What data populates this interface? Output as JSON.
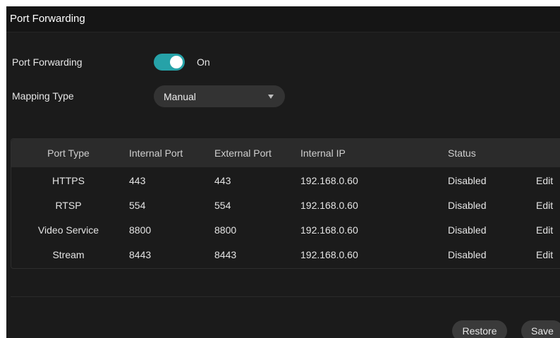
{
  "header": {
    "title": "Port Forwarding"
  },
  "form": {
    "port_forwarding_label": "Port Forwarding",
    "port_forwarding_state": "On",
    "port_forwarding_enabled": true,
    "mapping_type_label": "Mapping Type",
    "mapping_type_value": "Manual"
  },
  "table": {
    "headers": [
      "Port Type",
      "Internal Port",
      "External Port",
      "Internal IP",
      "Status"
    ],
    "rows": [
      {
        "type": "HTTPS",
        "internal_port": "443",
        "external_port": "443",
        "internal_ip": "192.168.0.60",
        "status": "Disabled",
        "action": "Edit"
      },
      {
        "type": "RTSP",
        "internal_port": "554",
        "external_port": "554",
        "internal_ip": "192.168.0.60",
        "status": "Disabled",
        "action": "Edit"
      },
      {
        "type": "Video Service",
        "internal_port": "8800",
        "external_port": "8800",
        "internal_ip": "192.168.0.60",
        "status": "Disabled",
        "action": "Edit"
      },
      {
        "type": "Stream",
        "internal_port": "8443",
        "external_port": "8443",
        "internal_ip": "192.168.0.60",
        "status": "Disabled",
        "action": "Edit"
      }
    ]
  },
  "footer": {
    "restore_label": "Restore",
    "save_label": "Save"
  },
  "colors": {
    "accent": "#26a2a8",
    "background": "#1b1b1b",
    "header_row": "#2b2b2b"
  }
}
